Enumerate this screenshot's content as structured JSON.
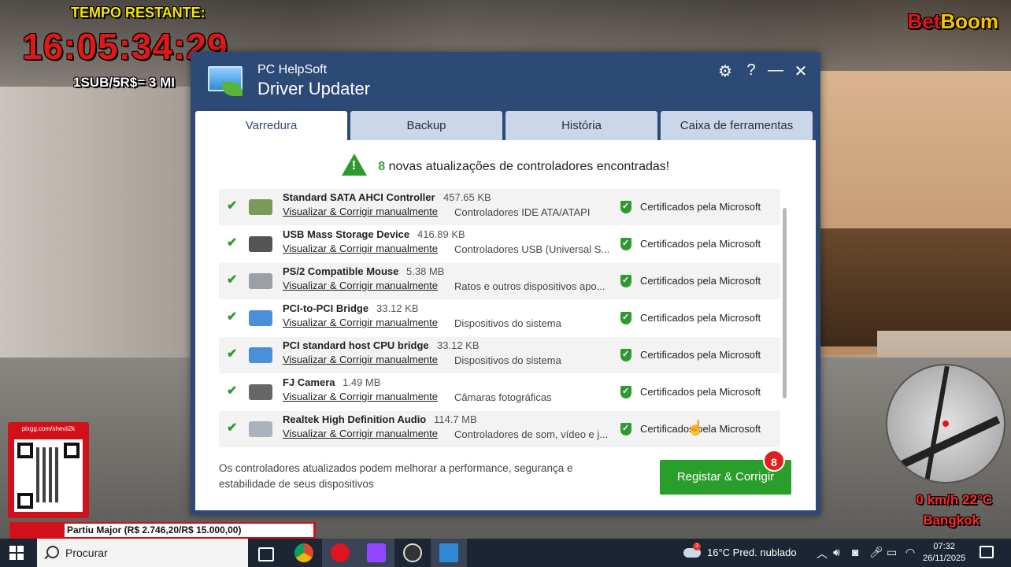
{
  "stream": {
    "timer_label": "TEMPO RESTANTE:",
    "timer": "16:05:34:29",
    "sub_text": "1SUB/5R$= 3 MI",
    "brand_part1": "Bet",
    "brand_part2": "Boom",
    "qr_label": "pixgg.com/shevii2k",
    "donation": "Partiu Major (R$ 2.746,20/R$ 15.000,00)",
    "speed": "0 km/h  22°C",
    "city": "Bangkok"
  },
  "window": {
    "brand": "PC HelpSoft",
    "title": "Driver Updater",
    "controls": [
      "⚙",
      "?",
      "—",
      "✕"
    ],
    "tabs": [
      "Varredura",
      "Backup",
      "História",
      "Caixa de ferramentas"
    ],
    "active_tab": 0
  },
  "scan": {
    "count": "8",
    "headline": "novas atualizações de controladores encontradas!",
    "manual_link": "Visualizar & Corrigir manualmente",
    "cert_label": "Certificados pela Microsoft",
    "drivers": [
      {
        "name": "Standard SATA AHCI Controller",
        "size": "457.65 KB",
        "category": "Controladores IDE ATA/ATAPI",
        "icon": "storage-controller-icon"
      },
      {
        "name": "USB Mass Storage Device",
        "size": "416.89 KB",
        "category": "Controladores USB (Universal S...",
        "icon": "usb-drive-icon"
      },
      {
        "name": "PS/2 Compatible Mouse",
        "size": "5.38 MB",
        "category": "Ratos e outros dispositivos apo...",
        "icon": "mouse-icon"
      },
      {
        "name": "PCI-to-PCI Bridge",
        "size": "33.12 KB",
        "category": "Dispositivos do sistema",
        "icon": "computer-icon"
      },
      {
        "name": "PCI standard host CPU bridge",
        "size": "33.12 KB",
        "category": "Dispositivos do sistema",
        "icon": "computer-icon"
      },
      {
        "name": "FJ Camera",
        "size": "1.49 MB",
        "category": "Câmaras fotográficas",
        "icon": "webcam-icon"
      },
      {
        "name": "Realtek High Definition Audio",
        "size": "114.7 MB",
        "category": "Controladores de som, vídeo e j...",
        "icon": "speaker-icon"
      }
    ],
    "footer": "Os controladores atualizados podem melhorar a performance, segurança e estabilidade de seus dispositivos",
    "fix_button": "Registar & Corrigir",
    "badge": "8"
  },
  "taskbar": {
    "search_placeholder": "Procurar",
    "weather_badge": "3",
    "weather": "16°C  Pred. nublado",
    "time": "07:32",
    "date": "26/11/2025",
    "colors": {
      "bg": "#1c2533",
      "accent": "#2a9e2a"
    }
  }
}
